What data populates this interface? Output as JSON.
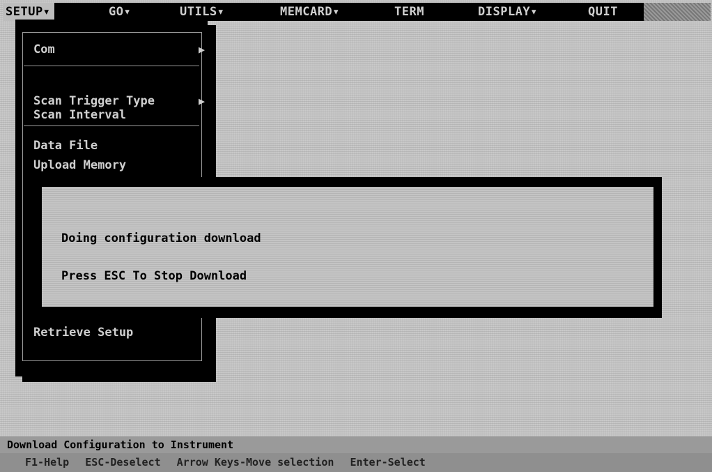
{
  "menubar": {
    "items": [
      {
        "label": "SETUP▾"
      },
      {
        "label": "GO▾"
      },
      {
        "label": "UTILS▾"
      },
      {
        "label": "MEMCARD▾"
      },
      {
        "label": "TERM"
      },
      {
        "label": "DISPLAY▾"
      },
      {
        "label": "QUIT"
      }
    ]
  },
  "dropdown": {
    "items": [
      {
        "label": "Com",
        "arrow": "▶"
      },
      {
        "label": "Scan Trigger Type",
        "arrow": "▶"
      },
      {
        "label": "Scan Interval"
      },
      {
        "label": "Data File"
      },
      {
        "label": "Upload Memory"
      },
      {
        "label": "Retrieve Setup"
      }
    ]
  },
  "dialog": {
    "message": "Doing configuration download",
    "hint": "Press ESC To Stop Download"
  },
  "status": {
    "description": "Download Configuration to Instrument",
    "keys": [
      "F1-Help",
      "ESC-Deselect",
      "Arrow Keys-Move selection",
      "Enter-Select"
    ]
  }
}
